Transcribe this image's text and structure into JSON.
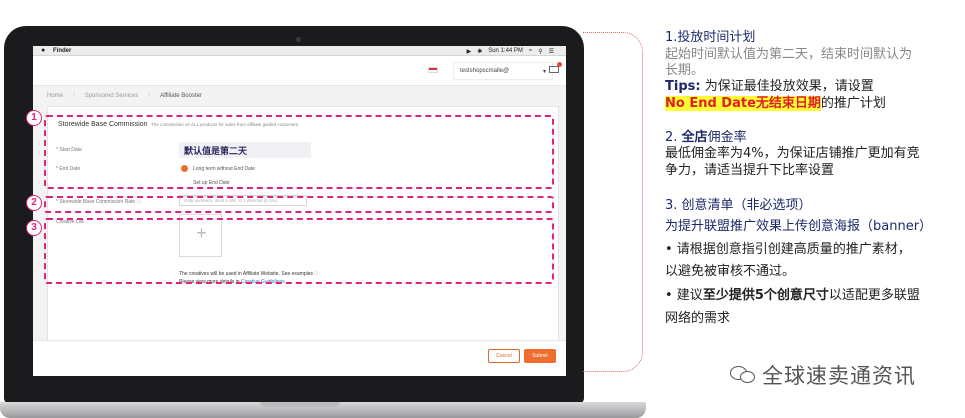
{
  "menubar": {
    "apple": "",
    "app": "Finder",
    "clock": "Sun 1:44 PM"
  },
  "header": {
    "account": "testshopscmalle@"
  },
  "breadcrumb": [
    "Home",
    "Sponsored Services",
    "Affiliate Booster"
  ],
  "form": {
    "section_title": "Storewide Base Commission",
    "section_subtitle": "The commission on ALL products for sales from affiliate guided customers",
    "start_date_label": "* Start Date",
    "start_date_value": "默认值是第二天",
    "end_date_label": "* End Date",
    "end_date_option": "Long term without End Date",
    "set_end_date": "Set up End Date",
    "rate_label": "* Storewide Base Commission Rate",
    "rate_placeholder": "Only numbers, must ≥ 4%, to 1 decimal (0.1%)",
    "creative_label": "Creative List",
    "creative_note": "The creatives will be used in Affiliate Website. See examples",
    "creative_note2_prefix": "Please view more details in",
    "creative_note2_link": "Creative Guidelines",
    "cancel": "Cancel",
    "submit": "Submit"
  },
  "markers": [
    "1",
    "2",
    "3"
  ],
  "notes": {
    "n1_title": "1.投放时间计划",
    "n1_line1": "起始时间默认值为第二天，结束时间默认为",
    "n1_line2": "长期。",
    "tip_label": "Tips:",
    "tip_text": " 为保证最佳投放效果，请设置",
    "tip_highlight": "No End Date无结束日期",
    "tip_tail": "的推广计划",
    "n2_prefix": "2. ",
    "n2_bold": "全店",
    "n2_title_rest": "佣金率",
    "n2_line1": "最低佣金率为4%，为保证店铺推广更加有竞",
    "n2_line2": "争力，请适当提升下比率设置",
    "n3_title": "3. 创意清单（非必选项）",
    "n3_line1": "为提升联盟推广效果上传创意海报（banner）",
    "n3_line2": "• 请根据创意指引创建高质量的推广素材，",
    "n3_line3": "以避免被审核不通过。",
    "n3_line4_prefix": "• 建议",
    "n3_line4_bold": "至少提供5个创意尺寸",
    "n3_line4_rest": "以适配更多联盟",
    "n3_line5": "网络的需求"
  },
  "watermark": "全球速卖通资讯",
  "colors": {
    "accent_orange": "#ee6e2f",
    "highlight_pink": "#e2237b",
    "title_navy": "#1c2a6a",
    "tip_red": "#e21d29",
    "tip_yellow": "#ffff33"
  }
}
